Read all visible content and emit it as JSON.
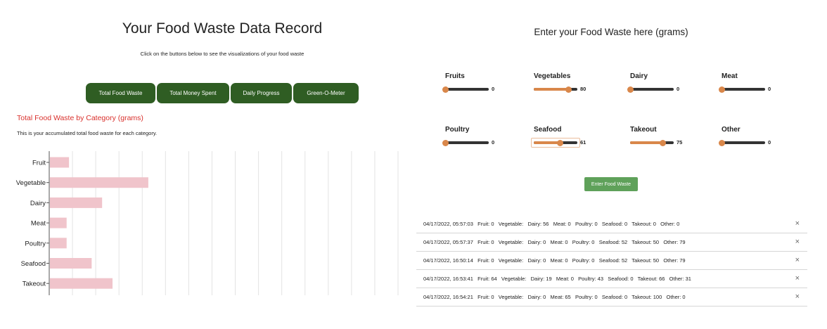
{
  "header": {
    "title": "Your Food Waste Data Record",
    "subtitle": "Click on the buttons below to see the visualizations of your food waste"
  },
  "nav_buttons": [
    {
      "label": "Total Food Waste"
    },
    {
      "label": "Total Money Spent"
    },
    {
      "label": "Daily Progress"
    },
    {
      "label": "Green-O-Meter"
    }
  ],
  "section": {
    "title": "Total Food Waste by Category (grams)",
    "description": "This is your accumulated total food waste for each category."
  },
  "chart_data": {
    "type": "bar",
    "orientation": "horizontal",
    "categories": [
      "Fruit",
      "Vegetable",
      "Dairy",
      "Meat",
      "Poultry",
      "Seafood",
      "Takeout"
    ],
    "values": [
      64,
      330,
      175,
      56,
      56,
      140,
      210
    ],
    "xlim": [
      0,
      1170
    ],
    "grid": true,
    "bar_color": "#f0c4cb"
  },
  "entry": {
    "title": "Enter your Food Waste here (grams)",
    "sliders": [
      {
        "label": "Fruits",
        "value": "0",
        "fraction": 0.0
      },
      {
        "label": "Vegetables",
        "value": "80",
        "fraction": 0.8
      },
      {
        "label": "Dairy",
        "value": "0",
        "fraction": 0.0
      },
      {
        "label": "Meat",
        "value": "0",
        "fraction": 0.0
      },
      {
        "label": "Poultry",
        "value": "0",
        "fraction": 0.0
      },
      {
        "label": "Seafood",
        "value": "61",
        "fraction": 0.61
      },
      {
        "label": "Takeout",
        "value": "75",
        "fraction": 0.75
      },
      {
        "label": "Other",
        "value": "0",
        "fraction": 0.0
      }
    ],
    "accent_color": "#d9874a",
    "submit_label": "Enter Food Waste"
  },
  "log": [
    {
      "text": "04/17/2022, 05:57:03   Fruit: 0   Vegetable:   Dairy: 56   Meat: 0   Poultry: 0   Seafood: 0   Takeout: 0   Other: 0"
    },
    {
      "text": "04/17/2022, 05:57:37   Fruit: 0   Vegetable:   Dairy: 0   Meat: 0   Poultry: 0   Seafood: 52   Takeout: 50   Other: 79"
    },
    {
      "text": "04/17/2022, 16:50:14   Fruit: 0   Vegetable:   Dairy: 0   Meat: 0   Poultry: 0   Seafood: 52   Takeout: 50   Other: 79"
    },
    {
      "text": "04/17/2022, 16:53:41   Fruit: 64   Vegetable:   Dairy: 19   Meat: 0   Poultry: 43   Seafood: 0   Takeout: 66   Other: 31"
    },
    {
      "text": "04/17/2022, 16:54:21   Fruit: 0   Vegetable:   Dairy: 0   Meat: 65   Poultry: 0   Seafood: 0   Takeout: 100   Other: 0"
    }
  ],
  "icons": {
    "remove": "close-icon",
    "remove_glyph": "×"
  }
}
